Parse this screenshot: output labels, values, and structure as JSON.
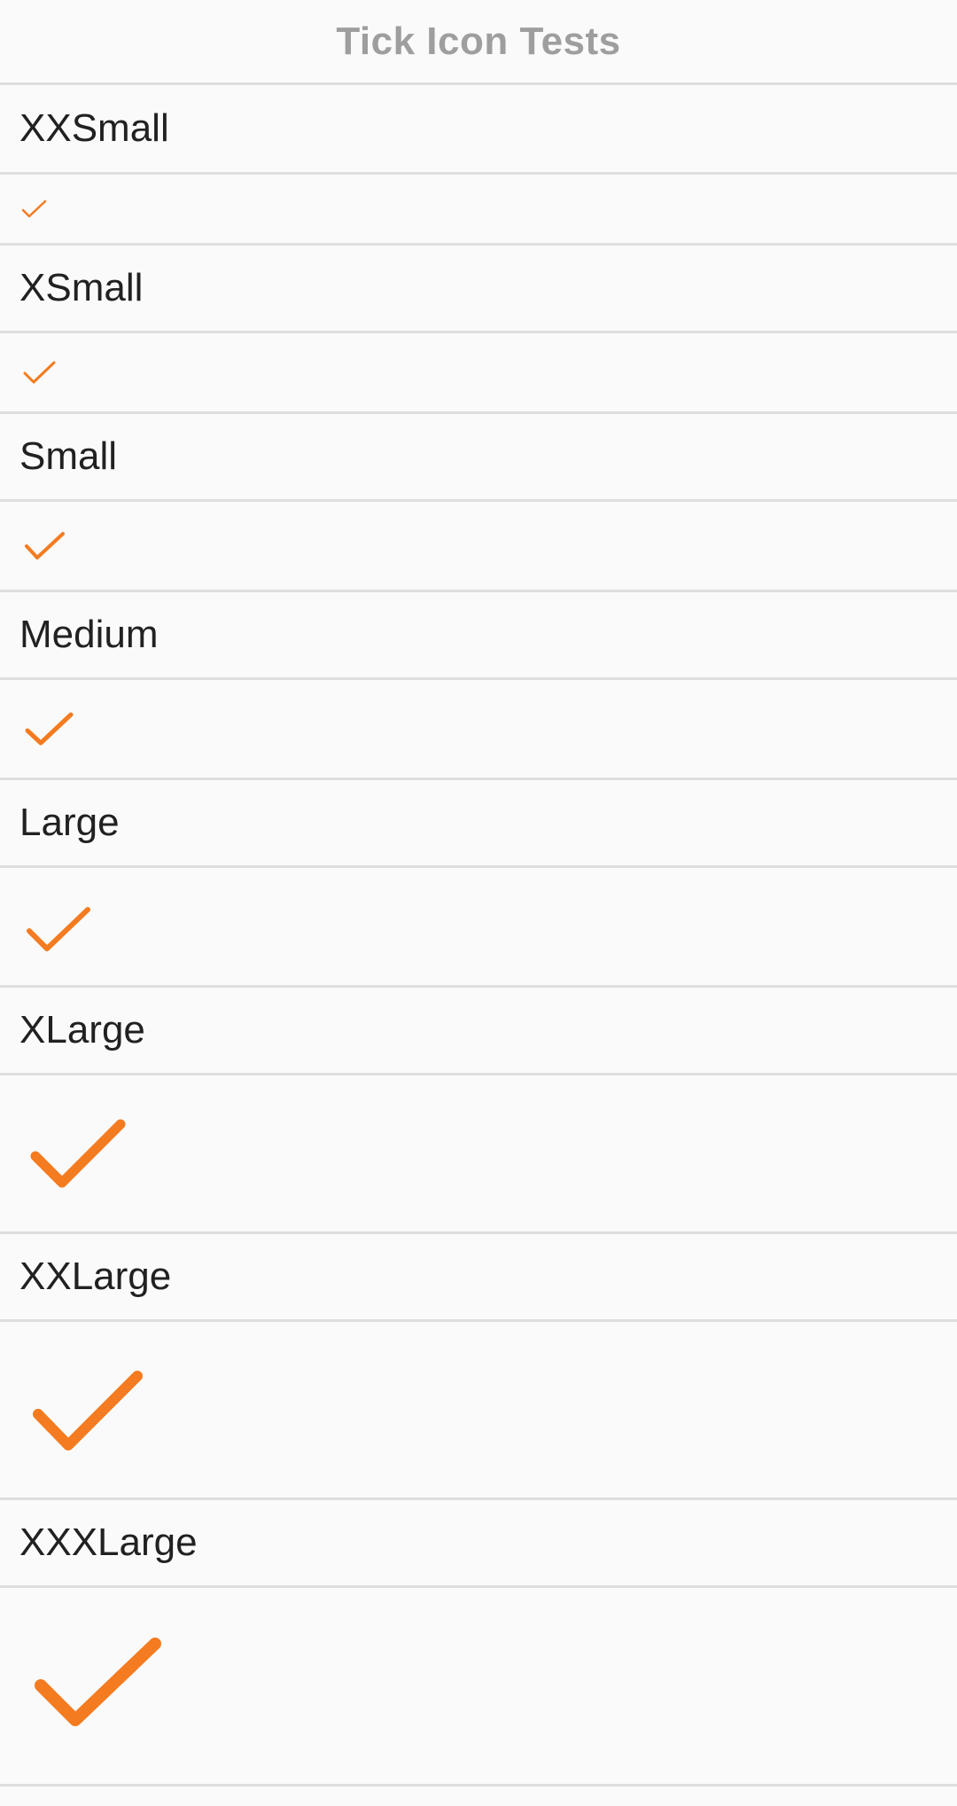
{
  "header": {
    "title": "Tick Icon Tests"
  },
  "theme": {
    "tick_color": "#f47b20",
    "divider_color": "#dedede"
  },
  "sections": [
    {
      "label": "XXSmall",
      "icon": "check-icon"
    },
    {
      "label": "XSmall",
      "icon": "check-icon"
    },
    {
      "label": "Small",
      "icon": "check-icon"
    },
    {
      "label": "Medium",
      "icon": "check-icon"
    },
    {
      "label": "Large",
      "icon": "check-icon"
    },
    {
      "label": "XLarge",
      "icon": "check-icon"
    },
    {
      "label": "XXLarge",
      "icon": "check-icon"
    },
    {
      "label": "XXXLarge",
      "icon": "check-icon"
    }
  ]
}
